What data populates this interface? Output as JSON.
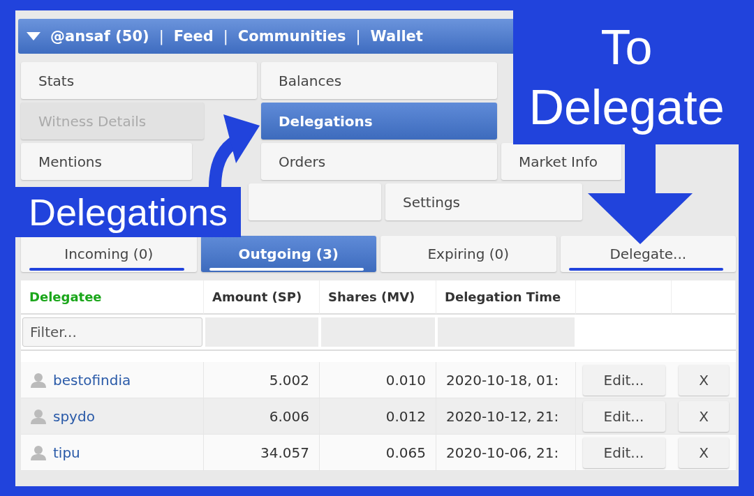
{
  "header": {
    "items": [
      {
        "kind": "link",
        "text": "@ansaf (50)"
      },
      {
        "kind": "separator",
        "text": "|"
      },
      {
        "kind": "link",
        "text": "Feed"
      },
      {
        "kind": "separator",
        "text": "|"
      },
      {
        "kind": "link",
        "text": "Communities"
      },
      {
        "kind": "separator",
        "text": "|"
      },
      {
        "kind": "link",
        "text": "Wallet"
      }
    ]
  },
  "menu": [
    [
      {
        "label": "Stats",
        "selected": false,
        "disabled": false
      },
      {
        "label": "Balances",
        "selected": false,
        "disabled": false
      }
    ],
    [
      {
        "label": "Witness Details",
        "selected": false,
        "disabled": true
      },
      {
        "label": "Delegations",
        "selected": true,
        "disabled": false
      }
    ],
    [
      {
        "label": "Mentions",
        "selected": false,
        "disabled": false
      },
      {
        "label": "Orders",
        "selected": false,
        "disabled": false
      },
      {
        "label": "Market Info",
        "selected": false,
        "disabled": false
      }
    ],
    [
      {
        "selected": false,
        "disabled": false
      },
      {
        "label": "Settings",
        "selected": false,
        "disabled": false
      }
    ]
  ],
  "subtabs": [
    {
      "label": "Incoming (0)",
      "selected": false,
      "underlined": true
    },
    {
      "label": "Outgoing (3)",
      "selected": true,
      "underlined": true
    },
    {
      "label": "Expiring (0)",
      "selected": false,
      "underlined": false
    },
    {
      "label": "Delegate...",
      "selected": false,
      "underlined": true
    }
  ],
  "table": {
    "columns": [
      {
        "label": "Delegatee",
        "sorted": true
      },
      {
        "label": "Amount (SP)",
        "sorted": false
      },
      {
        "label": "Shares (MV)",
        "sorted": false
      },
      {
        "label": "Delegation Time",
        "sorted": false
      }
    ],
    "filter": {
      "placeholder": "Filter..."
    },
    "rows": [
      {
        "delegatee": "bestofindia",
        "amount": "5.002",
        "shares": "0.010",
        "time": "2020-10-18, 01:",
        "edit": "Edit...",
        "remove": "X"
      },
      {
        "delegatee": "spydo",
        "amount": "6.006",
        "shares": "0.012",
        "time": "2020-10-12, 21:",
        "edit": "Edit...",
        "remove": "X"
      },
      {
        "delegatee": "tipu",
        "amount": "34.057",
        "shares": "0.065",
        "time": "2020-10-06, 21:",
        "edit": "Edit...",
        "remove": "X"
      }
    ]
  },
  "annotations": {
    "left_label": "Delegations",
    "right_label": "To Delegate"
  }
}
